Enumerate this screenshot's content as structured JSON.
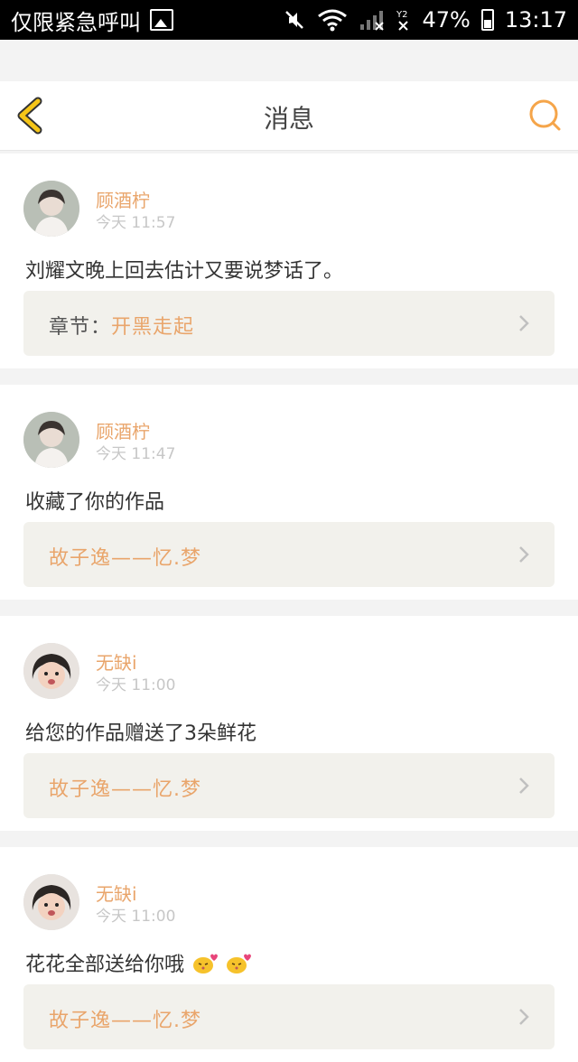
{
  "status_bar": {
    "carrier": "仅限紧急呼叫",
    "battery": "47%",
    "time": "13:17"
  },
  "header": {
    "title": "消息",
    "accent_color": "#f5a54a"
  },
  "messages": [
    {
      "user": "顾酒柠",
      "time": "今天 11:57",
      "text": "刘耀文晚上回去估计又要说梦话了。",
      "ref_prefix": "章节：",
      "ref": "开黑走起"
    },
    {
      "user": "顾酒柠",
      "time": "今天 11:47",
      "text": "收藏了你的作品",
      "ref_prefix": "",
      "ref": "故子逸——忆.梦"
    },
    {
      "user": "无缺i",
      "time": "今天 11:00",
      "text": "给您的作品赠送了3朵鲜花",
      "ref_prefix": "",
      "ref": "故子逸——忆.梦"
    },
    {
      "user": "无缺i",
      "time": "今天 11:00",
      "text": "花花全部送给你哦",
      "ref_prefix": "",
      "ref": "故子逸——忆.梦"
    }
  ]
}
